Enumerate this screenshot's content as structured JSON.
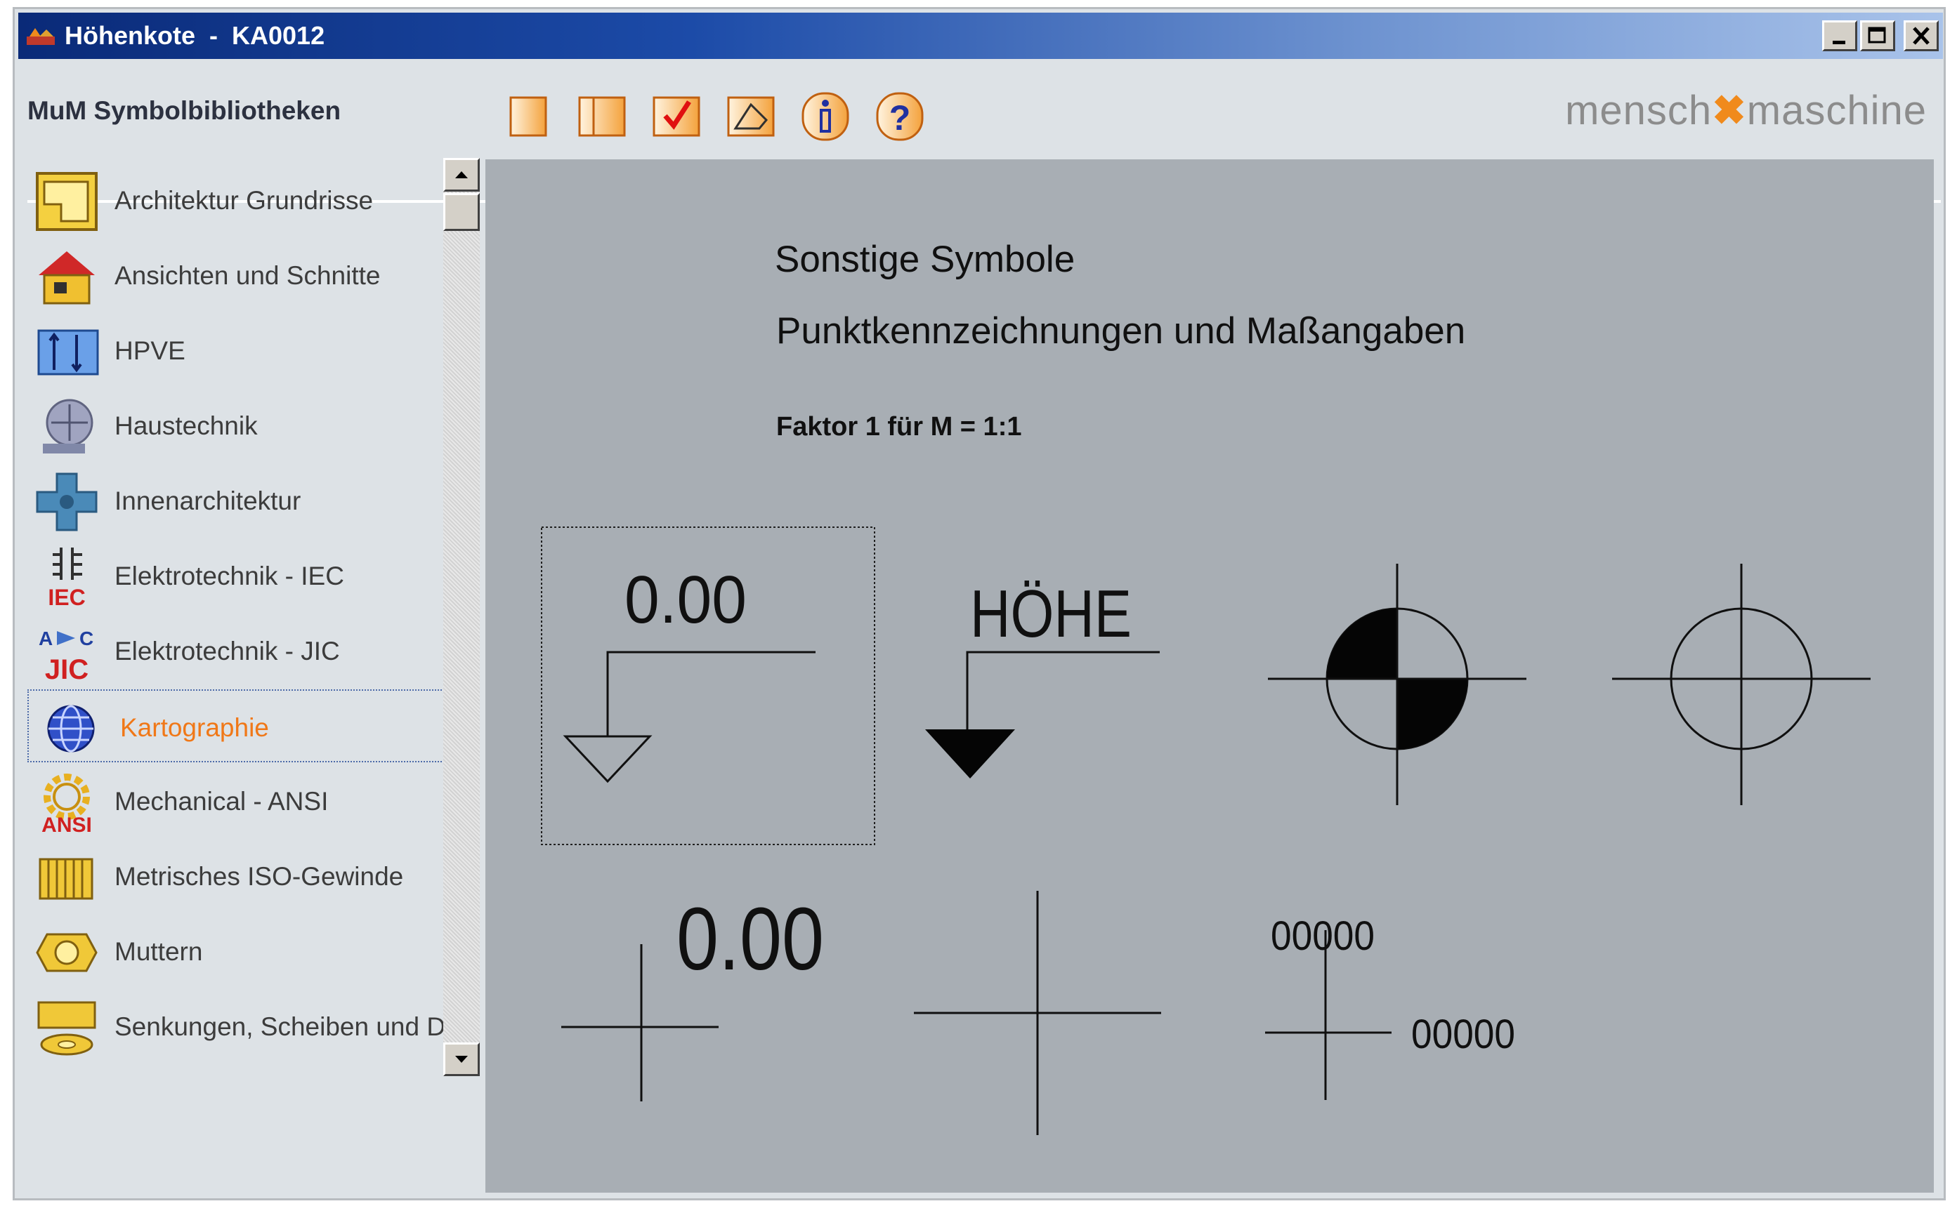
{
  "window": {
    "title": "Höhenkote  -  KA0012"
  },
  "toolbar": {
    "library_title": "MuM Symbolbibliotheken",
    "buttons": [
      {
        "icon": "blank-page-icon"
      },
      {
        "icon": "book-icon"
      },
      {
        "icon": "checkmark-icon"
      },
      {
        "icon": "insert-shape-icon"
      },
      {
        "icon": "info-icon"
      },
      {
        "icon": "help-icon"
      }
    ],
    "logo": {
      "part1": "mensch",
      "mark": "✖",
      "part2": "maschine"
    },
    "accent_color": "#f08a1c"
  },
  "sidebar": {
    "items": [
      {
        "label": "Architektur Grundrisse",
        "icon": "floorplan-icon"
      },
      {
        "label": "Ansichten und Schnitte",
        "icon": "house-icon"
      },
      {
        "label": "HPVE",
        "icon": "hpve-icon"
      },
      {
        "label": "Haustechnik",
        "icon": "building-services-icon"
      },
      {
        "label": "Innenarchitektur",
        "icon": "interior-icon"
      },
      {
        "label": "Elektrotechnik - IEC",
        "icon": "iec-icon",
        "badge": "IEC"
      },
      {
        "label": "Elektrotechnik - JIC",
        "icon": "jic-icon",
        "badge": "JIC"
      },
      {
        "label": "Kartographie",
        "icon": "globe-icon",
        "selected": true
      },
      {
        "label": "Mechanical - ANSI",
        "icon": "gear-icon",
        "badge": "ANSI"
      },
      {
        "label": "Metrisches ISO-Gewinde",
        "icon": "thread-icon"
      },
      {
        "label": "Muttern",
        "icon": "nut-icon"
      },
      {
        "label": "Senkungen, Scheiben und Du",
        "icon": "washer-icon"
      }
    ],
    "selected_color": "#f07818"
  },
  "preview": {
    "title": "Sonstige Symbole",
    "subtitle": "Punktkennzeichnungen und Maßangaben",
    "factor": "Faktor 1 für M = 1:1",
    "symbols": {
      "elevation_value": "0.00",
      "elevation_label": "HÖHE",
      "cross_value": "0.00",
      "coord_y": "00000",
      "coord_x": "00000"
    }
  }
}
